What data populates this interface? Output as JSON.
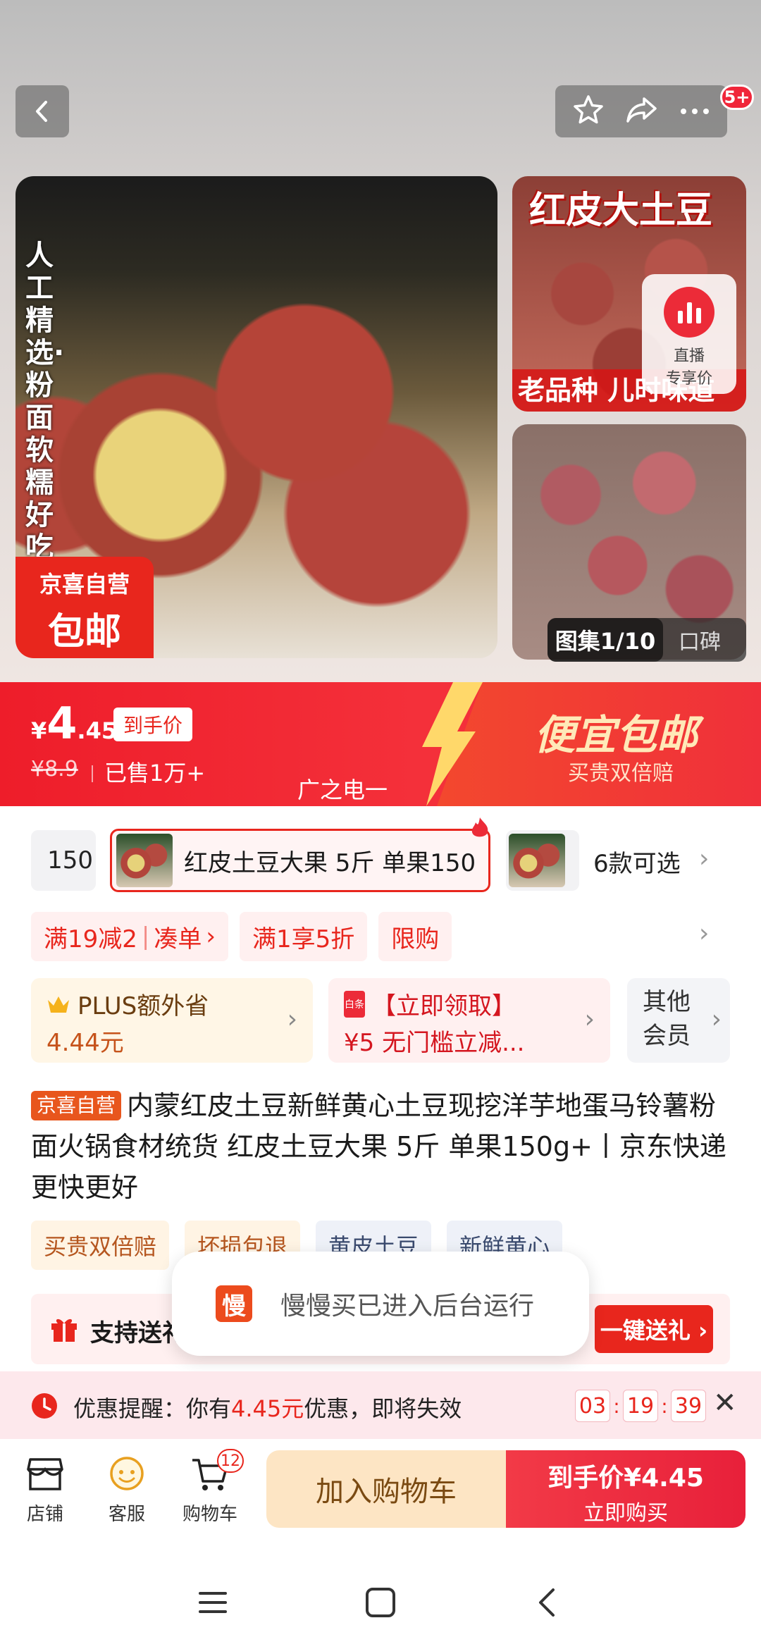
{
  "topbar": {
    "notif_count": "5+"
  },
  "hero": {
    "main_vertical_text": "人工精选·粉面软糯好吃",
    "main_tag_line1": "京喜自营",
    "main_tag_line2": "包邮",
    "side1_title": "红皮大土豆",
    "side1_bottom": "老品种 儿时味道",
    "live_label1": "直播",
    "live_label2": "专享价",
    "gallery_label": "图集1/10",
    "reviews_label": "口碑"
  },
  "price": {
    "currency": "¥",
    "integer": "4",
    "decimal": ".45",
    "tag": "到手价",
    "original": "¥8.9",
    "sold": "已售1万+",
    "promo_title": "便宜包邮",
    "promo_sub": "买贵双倍赔",
    "broadcast": "广之电一"
  },
  "variants": {
    "prev_text": "150",
    "active_text": "红皮土豆大果 5斤 单果150",
    "count_text": "6款可选"
  },
  "promos": [
    {
      "main": "满19减2",
      "action": "凑单"
    },
    {
      "main": "满1享5折"
    },
    {
      "main": "限购"
    }
  ],
  "cards": {
    "plus_line1": "PLUS额外省",
    "plus_line2": "4.44元",
    "coupon_line1": "【立即领取】",
    "coupon_line2": "¥5 无门槛立减...",
    "coupon_icon": "白条",
    "other_line1": "其他",
    "other_line2": "会员"
  },
  "product": {
    "tag": "京喜自营",
    "title": "内蒙红皮土豆新鲜黄心土豆现挖洋芋地蛋马铃薯粉面火锅食材统货 红皮土豆大果 5斤 单果150g+丨京东快递 更快更好"
  },
  "features": [
    "买贵双倍赔",
    "坏损包退",
    "黄皮土豆",
    "新鲜黄心"
  ],
  "gift": {
    "text": "支持送礼",
    "button": "一键送礼 ›"
  },
  "toast": {
    "app_glyph": "慢",
    "message": "慢慢买已进入后台运行"
  },
  "reminder": {
    "prefix": "优惠提醒：你有",
    "amount": "4.45元",
    "suffix": "优惠，即将失效",
    "hh": "03",
    "mm": "19",
    "ss": "39"
  },
  "bottom": {
    "store": "店铺",
    "service": "客服",
    "cart": "购物车",
    "cart_count": "12",
    "add_cart": "加入购物车",
    "buy_line1": "到手价¥4.45",
    "buy_line2": "立即购买"
  },
  "colors": {
    "brand_red": "#e8261d",
    "banner_red": "#ee1d2a",
    "gold_text": "#ffe9b8"
  }
}
